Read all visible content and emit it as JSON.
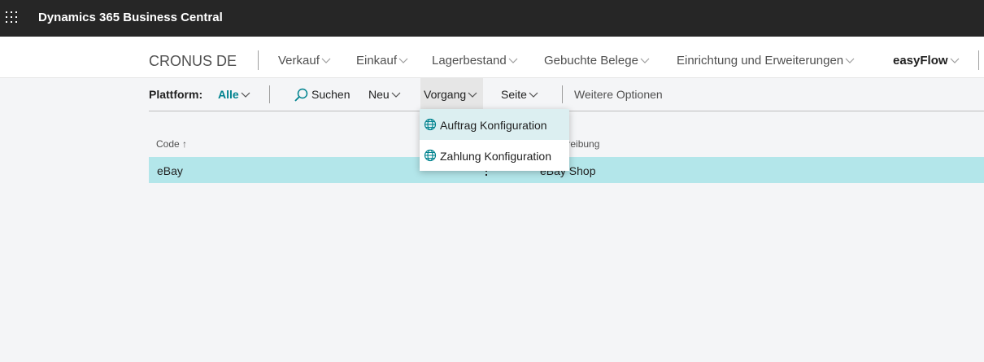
{
  "app": {
    "title": "Dynamics 365 Business Central"
  },
  "nav": {
    "company": "CRONUS DE",
    "items": [
      {
        "label": "Verkauf"
      },
      {
        "label": "Einkauf"
      },
      {
        "label": "Lagerbestand"
      },
      {
        "label": "Gebuchte Belege"
      },
      {
        "label": "Einrichtung und Erweiterungen"
      },
      {
        "label": "easyFlow"
      }
    ]
  },
  "actions": {
    "filter_label": "Plattform:",
    "filter_value": "Alle",
    "search": "Suchen",
    "new": "Neu",
    "process": "Vorgang",
    "page": "Seite",
    "more": "Weitere Optionen"
  },
  "dropdown": {
    "items": [
      {
        "label": "Auftrag Konfiguration",
        "icon": "globe-icon"
      },
      {
        "label": "Zahlung Konfiguration",
        "icon": "globe-icon"
      }
    ]
  },
  "grid": {
    "headers": {
      "code": "Code",
      "code_sort": "↑",
      "description": "Beschreibung"
    },
    "rows": [
      {
        "code": "eBay",
        "description": "eBay Shop"
      }
    ]
  },
  "colors": {
    "accent": "#00838f",
    "topbar": "#262626",
    "selected_row": "#b3e6ea"
  }
}
